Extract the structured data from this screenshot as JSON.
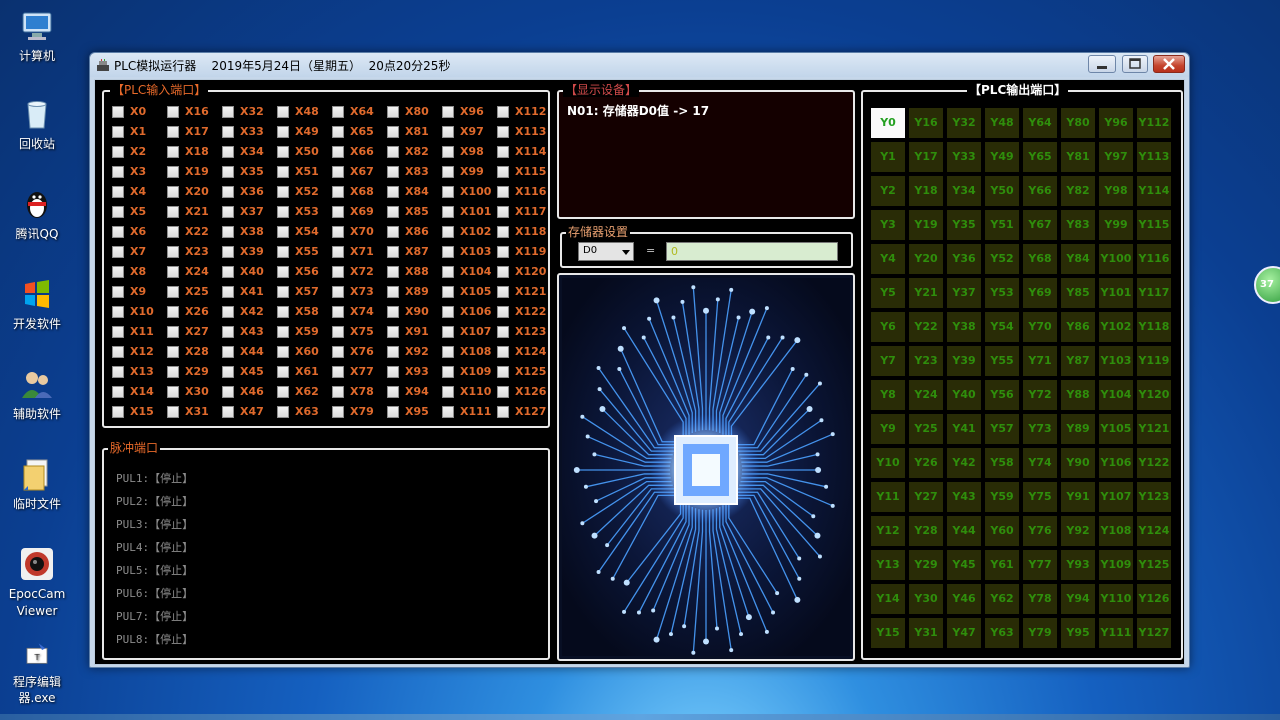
{
  "desktop": {
    "icons": [
      {
        "label": "计算机",
        "icon": "computer-icon"
      },
      {
        "label": "回收站",
        "icon": "recycle-bin-icon"
      },
      {
        "label": "腾讯QQ",
        "icon": "qq-penguin-icon"
      },
      {
        "label": "开发软件",
        "icon": "dev-software-icon"
      },
      {
        "label": "辅助软件",
        "icon": "users-icon"
      },
      {
        "label": "临时文件",
        "icon": "folder-files-icon"
      },
      {
        "label": "EpocCam Viewer",
        "icon": "webcam-icon"
      },
      {
        "label": "程序编辑器.exe",
        "icon": "program-editor-icon"
      }
    ],
    "side_badge": "37"
  },
  "window": {
    "title": "PLC模拟运行器    2019年5月24日（星期五）  20点20分25秒",
    "controls": {
      "minimize": "minimize-icon",
      "maximize": "maximize-icon",
      "close": "close-icon"
    }
  },
  "input_panel": {
    "title": "【PLC输入端口】",
    "columns": [
      [
        "X0",
        "X1",
        "X2",
        "X3",
        "X4",
        "X5",
        "X6",
        "X7",
        "X8",
        "X9",
        "X10",
        "X11",
        "X12",
        "X13",
        "X14",
        "X15"
      ],
      [
        "X16",
        "X17",
        "X18",
        "X19",
        "X20",
        "X21",
        "X22",
        "X23",
        "X24",
        "X25",
        "X26",
        "X27",
        "X28",
        "X29",
        "X30",
        "X31"
      ],
      [
        "X32",
        "X33",
        "X34",
        "X35",
        "X36",
        "X37",
        "X38",
        "X39",
        "X40",
        "X41",
        "X42",
        "X43",
        "X44",
        "X45",
        "X46",
        "X47"
      ],
      [
        "X48",
        "X49",
        "X50",
        "X51",
        "X52",
        "X53",
        "X54",
        "X55",
        "X56",
        "X57",
        "X58",
        "X59",
        "X60",
        "X61",
        "X62",
        "X63"
      ],
      [
        "X64",
        "X65",
        "X66",
        "X67",
        "X68",
        "X69",
        "X70",
        "X71",
        "X72",
        "X73",
        "X74",
        "X75",
        "X76",
        "X77",
        "X78",
        "X79"
      ],
      [
        "X80",
        "X81",
        "X82",
        "X83",
        "X84",
        "X85",
        "X86",
        "X87",
        "X88",
        "X89",
        "X90",
        "X91",
        "X92",
        "X93",
        "X94",
        "X95"
      ],
      [
        "X96",
        "X97",
        "X98",
        "X99",
        "X100",
        "X101",
        "X102",
        "X103",
        "X104",
        "X105",
        "X106",
        "X107",
        "X108",
        "X109",
        "X110",
        "X111"
      ],
      [
        "X112",
        "X113",
        "X114",
        "X115",
        "X116",
        "X117",
        "X118",
        "X119",
        "X120",
        "X121",
        "X122",
        "X123",
        "X124",
        "X125",
        "X126",
        "X127"
      ]
    ],
    "checked": []
  },
  "pulse_panel": {
    "title": "脉冲端口",
    "rows": [
      "PUL1:【停止】",
      "PUL2:【停止】",
      "PUL3:【停止】",
      "PUL4:【停止】",
      "PUL5:【停止】",
      "PUL6:【停止】",
      "PUL7:【停止】",
      "PUL8:【停止】"
    ]
  },
  "display_panel": {
    "title": "【显示设备】",
    "line": "N01: 存储器D0值 -> 17"
  },
  "memory_panel": {
    "title": "存储器设置",
    "selected": "D0",
    "equals": "=",
    "value": "0"
  },
  "output_panel": {
    "title": "【PLC输出端口】",
    "columns": [
      [
        "Y0",
        "Y1",
        "Y2",
        "Y3",
        "Y4",
        "Y5",
        "Y6",
        "Y7",
        "Y8",
        "Y9",
        "Y10",
        "Y11",
        "Y12",
        "Y13",
        "Y14",
        "Y15"
      ],
      [
        "Y16",
        "Y17",
        "Y18",
        "Y19",
        "Y20",
        "Y21",
        "Y22",
        "Y23",
        "Y24",
        "Y25",
        "Y26",
        "Y27",
        "Y28",
        "Y29",
        "Y30",
        "Y31"
      ],
      [
        "Y32",
        "Y33",
        "Y34",
        "Y35",
        "Y36",
        "Y37",
        "Y38",
        "Y39",
        "Y40",
        "Y41",
        "Y42",
        "Y43",
        "Y44",
        "Y45",
        "Y46",
        "Y47"
      ],
      [
        "Y48",
        "Y49",
        "Y50",
        "Y51",
        "Y52",
        "Y53",
        "Y54",
        "Y55",
        "Y56",
        "Y57",
        "Y58",
        "Y59",
        "Y60",
        "Y61",
        "Y62",
        "Y63"
      ],
      [
        "Y64",
        "Y65",
        "Y66",
        "Y67",
        "Y68",
        "Y69",
        "Y70",
        "Y71",
        "Y72",
        "Y73",
        "Y74",
        "Y75",
        "Y76",
        "Y77",
        "Y78",
        "Y79"
      ],
      [
        "Y80",
        "Y81",
        "Y82",
        "Y83",
        "Y84",
        "Y85",
        "Y86",
        "Y87",
        "Y88",
        "Y89",
        "Y90",
        "Y91",
        "Y92",
        "Y93",
        "Y94",
        "Y95"
      ],
      [
        "Y96",
        "Y97",
        "Y98",
        "Y99",
        "Y100",
        "Y101",
        "Y102",
        "Y103",
        "Y104",
        "Y105",
        "Y106",
        "Y107",
        "Y108",
        "Y109",
        "Y110",
        "Y111"
      ],
      [
        "Y112",
        "Y113",
        "Y114",
        "Y115",
        "Y116",
        "Y117",
        "Y118",
        "Y119",
        "Y120",
        "Y121",
        "Y122",
        "Y123",
        "Y124",
        "Y125",
        "Y126",
        "Y127"
      ]
    ],
    "active": [
      "Y0"
    ]
  },
  "colors": {
    "input_label": "#e06a2c",
    "panel_title_orange": "#e86a2a",
    "output_off_bg": "#292c06",
    "output_off_text": "#2f8e0c",
    "output_on_bg": "#fafafa",
    "chip_glow": "#5aa8ff"
  }
}
